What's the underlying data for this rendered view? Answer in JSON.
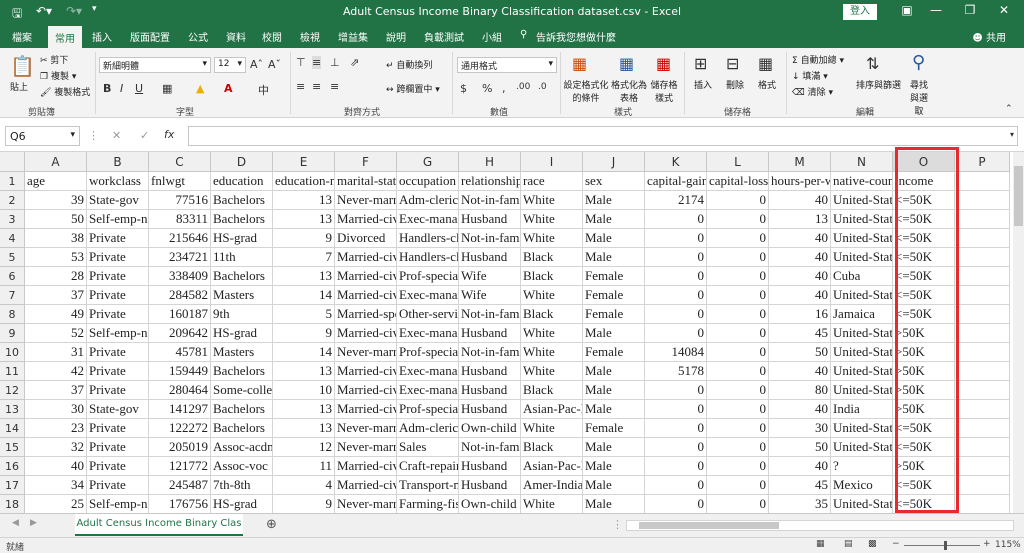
{
  "window": {
    "title": "Adult Census Income Binary Classification dataset.csv  -  Excel",
    "login": "登入"
  },
  "tabs": [
    "檔案",
    "常用",
    "插入",
    "版面配置",
    "公式",
    "資料",
    "校閱",
    "檢視",
    "增益集",
    "說明",
    "負載測試",
    "小組",
    "告訴我您想做什麼"
  ],
  "share": "共用",
  "ribbon": {
    "paste": "貼上",
    "cut": "剪下",
    "copy": "複製",
    "format_painter": "複製格式",
    "clipboard": "剪貼簿",
    "font_name": "新細明體",
    "font_size": "12",
    "font": "字型",
    "wrap": "自動換列",
    "merge": "跨欄置中",
    "alignment": "對齊方式",
    "number_format": "通用格式",
    "number": "數值",
    "cond": "設定格式化的條件",
    "table": "格式化為表格",
    "styles_btn": "儲存格樣式",
    "styles": "樣式",
    "insert": "插入",
    "delete": "刪除",
    "format": "格式",
    "cells": "儲存格",
    "autosum": "自動加總",
    "fill": "填滿",
    "clear": "清除",
    "sort": "排序與篩選",
    "find": "尋找與選取",
    "editing": "編輯"
  },
  "formula_bar": {
    "namebox": "Q6",
    "fx": "fx",
    "value": ""
  },
  "columns": [
    "A",
    "B",
    "C",
    "D",
    "E",
    "F",
    "G",
    "H",
    "I",
    "J",
    "K",
    "L",
    "M",
    "N",
    "O",
    "P"
  ],
  "rows": [
    [
      "age",
      "workclass",
      "fnlwgt",
      "education",
      "education-num",
      "marital-status",
      "occupation",
      "relationship",
      "race",
      "sex",
      "capital-gain",
      "capital-loss",
      "hours-per-week",
      "native-country",
      "income"
    ],
    [
      "39",
      "State-gov",
      "77516",
      "Bachelors",
      "13",
      "Never-married",
      "Adm-clerical",
      "Not-in-family",
      "White",
      "Male",
      "2174",
      "0",
      "40",
      "United-States",
      "<=50K"
    ],
    [
      "50",
      "Self-emp-not-inc",
      "83311",
      "Bachelors",
      "13",
      "Married-civ-spouse",
      "Exec-managerial",
      "Husband",
      "White",
      "Male",
      "0",
      "0",
      "13",
      "United-States",
      "<=50K"
    ],
    [
      "38",
      "Private",
      "215646",
      "HS-grad",
      "9",
      "Divorced",
      "Handlers-cleaners",
      "Not-in-family",
      "White",
      "Male",
      "0",
      "0",
      "40",
      "United-States",
      "<=50K"
    ],
    [
      "53",
      "Private",
      "234721",
      "11th",
      "7",
      "Married-civ-spouse",
      "Handlers-cleaners",
      "Husband",
      "Black",
      "Male",
      "0",
      "0",
      "40",
      "United-States",
      "<=50K"
    ],
    [
      "28",
      "Private",
      "338409",
      "Bachelors",
      "13",
      "Married-civ-spouse",
      "Prof-specialty",
      "Wife",
      "Black",
      "Female",
      "0",
      "0",
      "40",
      "Cuba",
      "<=50K"
    ],
    [
      "37",
      "Private",
      "284582",
      "Masters",
      "14",
      "Married-civ-spouse",
      "Exec-managerial",
      "Wife",
      "White",
      "Female",
      "0",
      "0",
      "40",
      "United-States",
      "<=50K"
    ],
    [
      "49",
      "Private",
      "160187",
      "9th",
      "5",
      "Married-spouse-absent",
      "Other-service",
      "Not-in-family",
      "Black",
      "Female",
      "0",
      "0",
      "16",
      "Jamaica",
      "<=50K"
    ],
    [
      "52",
      "Self-emp-not-inc",
      "209642",
      "HS-grad",
      "9",
      "Married-civ-spouse",
      "Exec-managerial",
      "Husband",
      "White",
      "Male",
      "0",
      "0",
      "45",
      "United-States",
      ">50K"
    ],
    [
      "31",
      "Private",
      "45781",
      "Masters",
      "14",
      "Never-married",
      "Prof-specialty",
      "Not-in-family",
      "White",
      "Female",
      "14084",
      "0",
      "50",
      "United-States",
      ">50K"
    ],
    [
      "42",
      "Private",
      "159449",
      "Bachelors",
      "13",
      "Married-civ-spouse",
      "Exec-managerial",
      "Husband",
      "White",
      "Male",
      "5178",
      "0",
      "40",
      "United-States",
      ">50K"
    ],
    [
      "37",
      "Private",
      "280464",
      "Some-college",
      "10",
      "Married-civ-spouse",
      "Exec-managerial",
      "Husband",
      "Black",
      "Male",
      "0",
      "0",
      "80",
      "United-States",
      ">50K"
    ],
    [
      "30",
      "State-gov",
      "141297",
      "Bachelors",
      "13",
      "Married-civ-spouse",
      "Prof-specialty",
      "Husband",
      "Asian-Pac-Islander",
      "Male",
      "0",
      "0",
      "40",
      "India",
      ">50K"
    ],
    [
      "23",
      "Private",
      "122272",
      "Bachelors",
      "13",
      "Never-married",
      "Adm-clerical",
      "Own-child",
      "White",
      "Female",
      "0",
      "0",
      "30",
      "United-States",
      "<=50K"
    ],
    [
      "32",
      "Private",
      "205019",
      "Assoc-acdm",
      "12",
      "Never-married",
      "Sales",
      "Not-in-family",
      "Black",
      "Male",
      "0",
      "0",
      "50",
      "United-States",
      "<=50K"
    ],
    [
      "40",
      "Private",
      "121772",
      "Assoc-voc",
      "11",
      "Married-civ-spouse",
      "Craft-repair",
      "Husband",
      "Asian-Pac-Islander",
      "Male",
      "0",
      "0",
      "40",
      "?",
      ">50K"
    ],
    [
      "34",
      "Private",
      "245487",
      "7th-8th",
      "4",
      "Married-civ-spouse",
      "Transport-moving",
      "Husband",
      "Amer-Indian-Eskimo",
      "Male",
      "0",
      "0",
      "45",
      "Mexico",
      "<=50K"
    ],
    [
      "25",
      "Self-emp-not-inc",
      "176756",
      "HS-grad",
      "9",
      "Never-married",
      "Farming-fishing",
      "Own-child",
      "White",
      "Male",
      "0",
      "0",
      "35",
      "United-States",
      "<=50K"
    ]
  ],
  "sheet_tab": "Adult Census Income Binary Clas",
  "status": {
    "ready": "就緒",
    "zoom": "115%"
  }
}
